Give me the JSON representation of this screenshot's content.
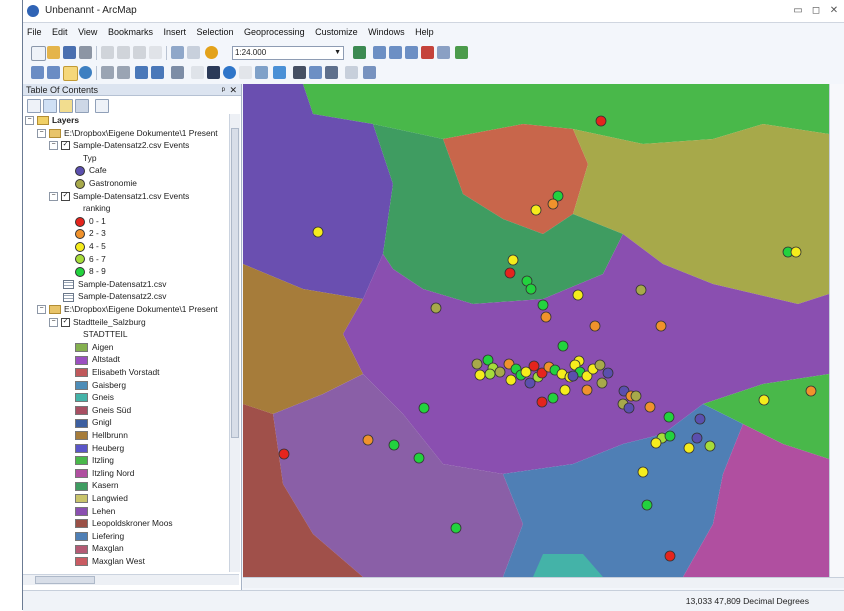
{
  "window": {
    "title": "Unbenannt - ArcMap",
    "controls": [
      "▭",
      "◻",
      "✕"
    ]
  },
  "menu": [
    "File",
    "Edit",
    "View",
    "Bookmarks",
    "Insert",
    "Selection",
    "Geoprocessing",
    "Customize",
    "Windows",
    "Help"
  ],
  "toolbar": {
    "scale": "1:24.000"
  },
  "toc": {
    "title": "Table Of Contents",
    "pin": "ᵖ",
    "close": "✕",
    "rows": [
      {
        "indent": 2,
        "kind": "layers",
        "label": "Layers",
        "bold": true,
        "exp": "−"
      },
      {
        "indent": 14,
        "kind": "folder",
        "label": "E:\\Dropbox\\Eigene Dokumente\\1 Present",
        "exp": "−"
      },
      {
        "indent": 26,
        "kind": "layer",
        "label": "Sample-Datensatz2.csv Events",
        "exp": "−"
      },
      {
        "indent": 60,
        "kind": "text",
        "label": "Typ"
      },
      {
        "indent": 52,
        "kind": "dot",
        "color": "#5b4fae",
        "label": "Cafe"
      },
      {
        "indent": 52,
        "kind": "dot",
        "color": "#a7a94a",
        "label": "Gastronomie"
      },
      {
        "indent": 26,
        "kind": "layer",
        "label": "Sample-Datensatz1.csv Events",
        "exp": "−"
      },
      {
        "indent": 60,
        "kind": "text",
        "label": "ranking"
      },
      {
        "indent": 52,
        "kind": "dot",
        "color": "#e5241d",
        "label": "0 - 1"
      },
      {
        "indent": 52,
        "kind": "dot",
        "color": "#f0922c",
        "label": "2 - 3"
      },
      {
        "indent": 52,
        "kind": "dot",
        "color": "#f5ec1c",
        "label": "4 - 5"
      },
      {
        "indent": 52,
        "kind": "dot",
        "color": "#a6dc3a",
        "label": "6 - 7"
      },
      {
        "indent": 52,
        "kind": "dot",
        "color": "#22d23e",
        "label": "8 - 9"
      },
      {
        "indent": 40,
        "kind": "table",
        "label": "Sample-Datensatz1.csv"
      },
      {
        "indent": 40,
        "kind": "table",
        "label": "Sample-Datensatz2.csv"
      },
      {
        "indent": 14,
        "kind": "folder",
        "label": "E:\\Dropbox\\Eigene Dokumente\\1 Present",
        "exp": "−"
      },
      {
        "indent": 26,
        "kind": "layer",
        "label": "Stadtteile_Salzburg",
        "exp": "−"
      },
      {
        "indent": 60,
        "kind": "text",
        "label": "STADTTEIL"
      },
      {
        "indent": 52,
        "kind": "swatch",
        "color": "#84b04f",
        "label": "Aigen"
      },
      {
        "indent": 52,
        "kind": "swatch",
        "color": "#9b4fc0",
        "label": "Altstadt"
      },
      {
        "indent": 52,
        "kind": "swatch",
        "color": "#c0595b",
        "label": "Elisabeth Vorstadt"
      },
      {
        "indent": 52,
        "kind": "swatch",
        "color": "#4d8db8",
        "label": "Gaisberg"
      },
      {
        "indent": 52,
        "kind": "swatch",
        "color": "#44b3a8",
        "label": "Gneis"
      },
      {
        "indent": 52,
        "kind": "swatch",
        "color": "#a84f62",
        "label": "Gneis Süd"
      },
      {
        "indent": 52,
        "kind": "swatch",
        "color": "#3d5fa0",
        "label": "Gnigl"
      },
      {
        "indent": 52,
        "kind": "swatch",
        "color": "#a67c3a",
        "label": "Hellbrunn"
      },
      {
        "indent": 52,
        "kind": "swatch",
        "color": "#5a55c8",
        "label": "Heuberg"
      },
      {
        "indent": 52,
        "kind": "swatch",
        "color": "#49b84a",
        "label": "Itzling"
      },
      {
        "indent": 52,
        "kind": "swatch",
        "color": "#b04fa0",
        "label": "Itzling Nord"
      },
      {
        "indent": 52,
        "kind": "swatch",
        "color": "#3f9c61",
        "label": "Kasern"
      },
      {
        "indent": 52,
        "kind": "swatch",
        "color": "#c9c46a",
        "label": "Langwied"
      },
      {
        "indent": 52,
        "kind": "swatch",
        "color": "#8a4fb0",
        "label": "Lehen"
      },
      {
        "indent": 52,
        "kind": "swatch",
        "color": "#9a5046",
        "label": "Leopoldskroner Moos"
      },
      {
        "indent": 52,
        "kind": "swatch",
        "color": "#4f7fb5",
        "label": "Liefering"
      },
      {
        "indent": 52,
        "kind": "swatch",
        "color": "#b45a74",
        "label": "Maxglan"
      },
      {
        "indent": 52,
        "kind": "swatch",
        "color": "#c95b62",
        "label": "Maxglan West"
      }
    ]
  },
  "status": {
    "coords": "13,033  47,809 Decimal Degrees"
  },
  "map": {
    "points": [
      {
        "type": "ranking",
        "color": "#e5241d"
      },
      {
        "type": "ranking",
        "color": "#f5ec1c"
      },
      {
        "type": "ranking",
        "color": "#22d23e"
      },
      {
        "type": "ranking",
        "color": "#f0922c"
      },
      {
        "type": "ranking",
        "color": "#a6dc3a"
      },
      {
        "type": "typ",
        "color": "#5b4fae"
      },
      {
        "type": "typ",
        "color": "#a7a94a"
      }
    ]
  }
}
